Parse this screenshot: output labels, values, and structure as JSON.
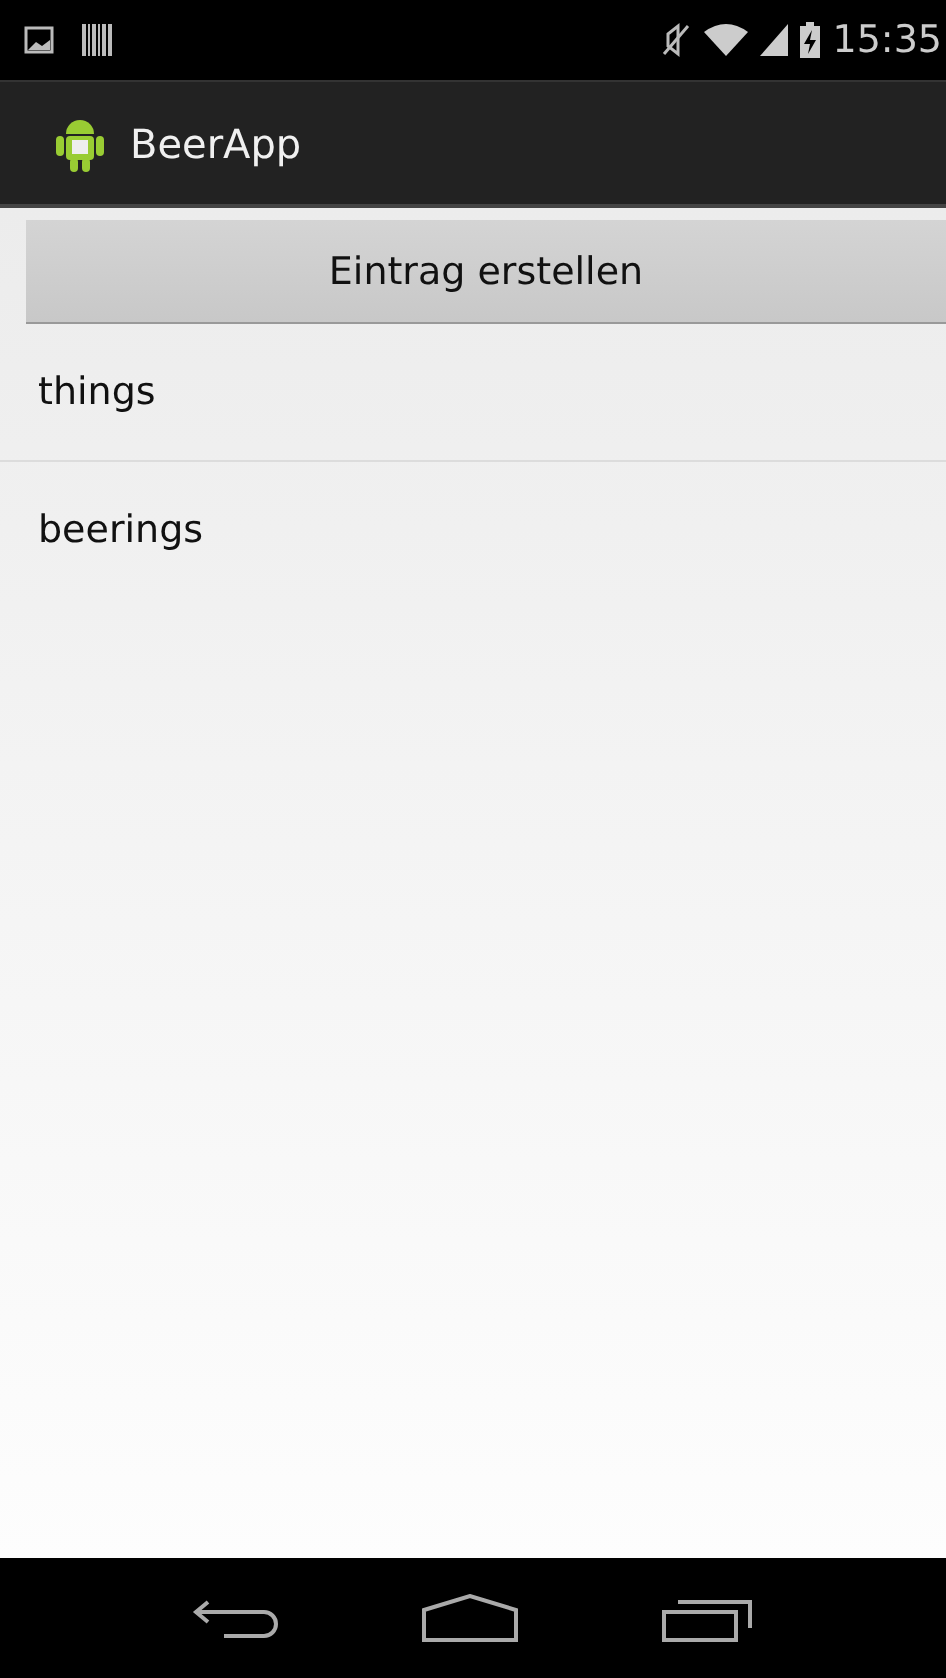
{
  "status_bar": {
    "time": "15:35"
  },
  "action_bar": {
    "title": "BeerApp"
  },
  "create_button": {
    "label": "Eintrag erstellen"
  },
  "entries": [
    {
      "label": "things"
    },
    {
      "label": "beerings"
    }
  ]
}
